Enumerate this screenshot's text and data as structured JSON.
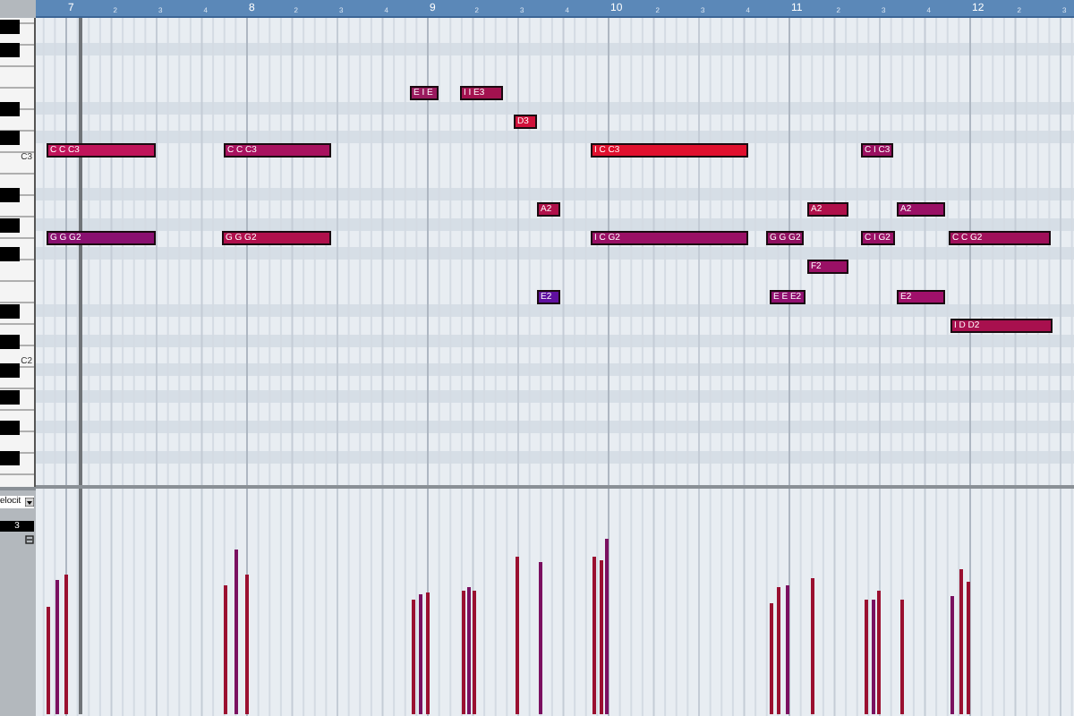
{
  "ruler": {
    "bars": [
      {
        "label": "7",
        "beats": [
          "2",
          "3",
          "4"
        ]
      },
      {
        "label": "8",
        "beats": [
          "2",
          "3",
          "4"
        ]
      },
      {
        "label": "9",
        "beats": [
          "2",
          "3",
          "4"
        ]
      },
      {
        "label": "10",
        "beats": [
          "2",
          "3",
          "4"
        ]
      },
      {
        "label": "11",
        "beats": [
          "2",
          "3",
          "4"
        ]
      },
      {
        "label": "12",
        "beats": [
          "2",
          "3"
        ]
      }
    ]
  },
  "keyboard": {
    "labels": [
      "C3",
      "C2"
    ]
  },
  "notes": [
    {
      "label": "C C C3",
      "color": "#c0145a"
    },
    {
      "label": "C C C3",
      "color": "#a8125f"
    },
    {
      "label": "E I E",
      "color": "#9a1a5e"
    },
    {
      "label": "I I E3",
      "color": "#a3124f"
    },
    {
      "label": "D3",
      "color": "#d0103a"
    },
    {
      "label": "I C C3",
      "color": "#e0102e"
    },
    {
      "label": "C I C3",
      "color": "#9a1060"
    },
    {
      "label": "A2",
      "color": "#b0104a"
    },
    {
      "label": "A2",
      "color": "#b0104a"
    },
    {
      "label": "A2",
      "color": "#9a1065"
    },
    {
      "label": "G G G2",
      "color": "#8a1070"
    },
    {
      "label": "G G G2",
      "color": "#b0104c"
    },
    {
      "label": "I C G2",
      "color": "#9a1065"
    },
    {
      "label": "G G G2",
      "color": "#901060"
    },
    {
      "label": "C I G2",
      "color": "#9a1065"
    },
    {
      "label": "C C G2",
      "color": "#a0105a"
    },
    {
      "label": "F2",
      "color": "#9a1065"
    },
    {
      "label": "E2",
      "color": "#6010a0"
    },
    {
      "label": "E E E2",
      "color": "#901070"
    },
    {
      "label": "E2",
      "color": "#a0106a"
    },
    {
      "label": "I D D2",
      "color": "#a8104e"
    }
  ],
  "controller_lane": {
    "parameter": "elocit",
    "value": "3"
  }
}
